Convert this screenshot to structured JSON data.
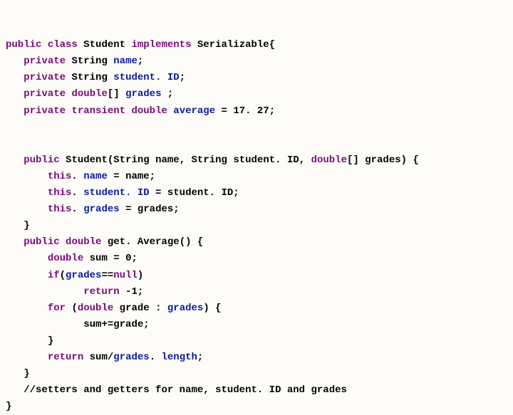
{
  "kw": {
    "public": "public",
    "class": "class",
    "implements": "implements",
    "private": "private",
    "transient": "transient",
    "double": "double",
    "this": "this",
    "if": "if",
    "null": "null",
    "return": "return",
    "for": "for"
  },
  "cls": {
    "name": "Student",
    "iface": "Serializable"
  },
  "type": {
    "String": "String"
  },
  "field": {
    "name": "name",
    "studentID": "student. ID",
    "grades": "grades",
    "average": "average"
  },
  "init": {
    "average": "17. 27"
  },
  "ctor": {
    "p_name": "name",
    "p_studentID": "student. ID",
    "p_grades": "grades"
  },
  "method": {
    "getAverage": "get. Average",
    "sum": "sum",
    "zero": "0",
    "neg1": "-1",
    "grade": "grade",
    "length": "length"
  },
  "comment": "//setters and getters for name, student. ID and grades",
  "punct": {
    "obrace": "{",
    "cbrace": "}",
    "semi": ";",
    "eq": " = ",
    "comma": ", ",
    "arr": "[]",
    "oparen": "(",
    "cparen": ")",
    "dot": ". ",
    "colon": " : ",
    "eqeq": "==",
    "pluseq": "+=",
    "slash": "/",
    "space": " "
  }
}
